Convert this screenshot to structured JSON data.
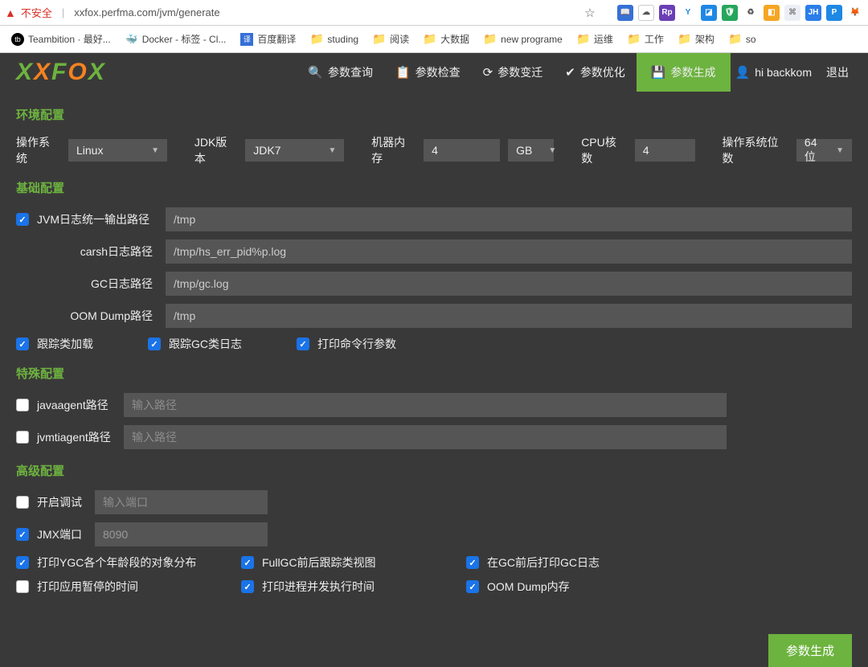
{
  "browser": {
    "insecure_label": "不安全",
    "url": "xxfox.perfma.com/jvm/generate",
    "bookmarks": [
      {
        "label": "Teambition · 最好...",
        "icon": "tb"
      },
      {
        "label": "Docker - 标签 - Cl...",
        "icon": "docker"
      },
      {
        "label": "百度翻译",
        "icon": "baidu"
      },
      {
        "label": "studing",
        "icon": "folder"
      },
      {
        "label": "阅读",
        "icon": "folder"
      },
      {
        "label": "大数据",
        "icon": "folder"
      },
      {
        "label": "new programe",
        "icon": "folder"
      },
      {
        "label": "运维",
        "icon": "folder"
      },
      {
        "label": "工作",
        "icon": "folder"
      },
      {
        "label": "架构",
        "icon": "folder"
      },
      {
        "label": "so",
        "icon": "folder"
      }
    ]
  },
  "nav": {
    "items": [
      {
        "label": "参数查询",
        "icon": "🔍"
      },
      {
        "label": "参数检查",
        "icon": "📋"
      },
      {
        "label": "参数变迁",
        "icon": "⟳"
      },
      {
        "label": "参数优化",
        "icon": "✔"
      },
      {
        "label": "参数生成",
        "icon": "🖶",
        "active": true
      }
    ],
    "user_label": "hi backkom",
    "logout": "退出"
  },
  "env": {
    "title": "环境配置",
    "os_label": "操作系统",
    "os_value": "Linux",
    "jdk_label": "JDK版本",
    "jdk_value": "JDK7",
    "mem_label": "机器内存",
    "mem_value": "4",
    "mem_unit": "GB",
    "cpu_label": "CPU核数",
    "cpu_value": "4",
    "bits_label": "操作系统位数",
    "bits_value": "64位"
  },
  "base": {
    "title": "基础配置",
    "logpath_label": "JVM日志统一输出路径",
    "logpath_value": "/tmp",
    "crash_label": "carsh日志路径",
    "crash_value": "/tmp/hs_err_pid%p.log",
    "gc_label": "GC日志路径",
    "gc_value": "/tmp/gc.log",
    "oom_label": "OOM Dump路径",
    "oom_value": "/tmp",
    "cb1": "跟踪类加载",
    "cb2": "跟踪GC类日志",
    "cb3": "打印命令行参数"
  },
  "special": {
    "title": "特殊配置",
    "javaagent_label": "javaagent路径",
    "javaagent_ph": "输入路径",
    "jvmti_label": "jvmtiagent路径",
    "jvmti_ph": "输入路径"
  },
  "adv": {
    "title": "高级配置",
    "debug_label": "开启调试",
    "debug_ph": "输入端口",
    "jmx_label": "JMX端口",
    "jmx_value": "8090",
    "g": [
      {
        "label": "打印YGC各个年龄段的对象分布",
        "checked": true
      },
      {
        "label": "FullGC前后跟踪类视图",
        "checked": true
      },
      {
        "label": "在GC前后打印GC日志",
        "checked": true
      },
      {
        "label": "打印应用暂停的时间",
        "checked": false
      },
      {
        "label": "打印进程并发执行时间",
        "checked": true
      },
      {
        "label": "OOM Dump内存",
        "checked": true
      }
    ]
  },
  "submit": "参数生成"
}
